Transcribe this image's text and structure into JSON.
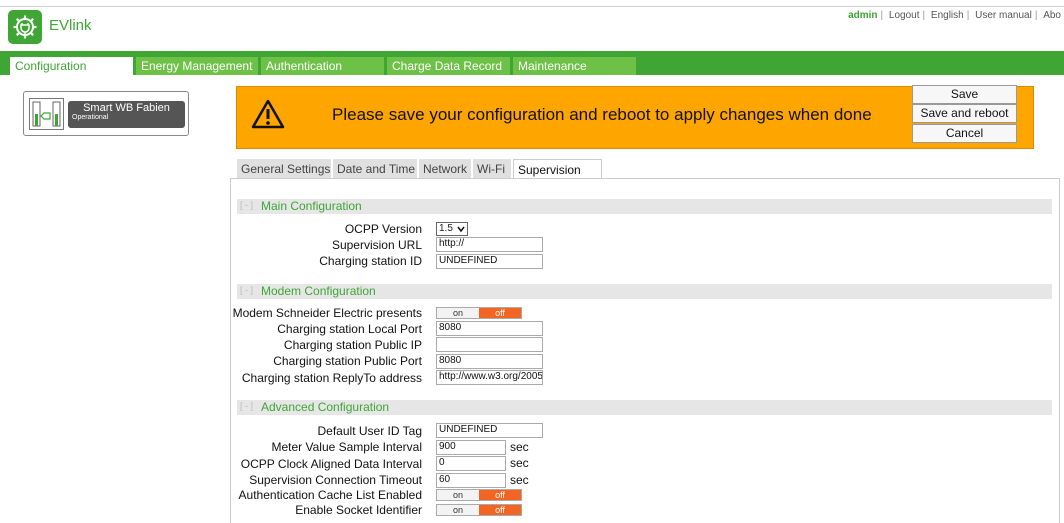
{
  "app": {
    "brand": "EVlink",
    "logo_icon": "gear-plug-icon",
    "accent": "#3fa535"
  },
  "toplinks": {
    "user": "admin",
    "logout": "Logout",
    "language": "English",
    "manual": "User manual",
    "about": "Abo"
  },
  "nav": {
    "tabs": [
      {
        "label": "Configuration",
        "active": true
      },
      {
        "label": "Energy Management"
      },
      {
        "label": "Authentication"
      },
      {
        "label": "Charge Data Record"
      },
      {
        "label": "Maintenance"
      }
    ]
  },
  "station": {
    "name": "Smart WB Fabien",
    "status": "Operational"
  },
  "banner": {
    "message": "Please save your configuration and reboot to apply changes when done",
    "color": "#ffa500"
  },
  "actions": {
    "save": "Save",
    "save_reboot": "Save and reboot",
    "cancel": "Cancel"
  },
  "subtabs": {
    "items": [
      {
        "label": "General Settings"
      },
      {
        "label": "Date and Time"
      },
      {
        "label": "Network"
      },
      {
        "label": "Wi-Fi"
      },
      {
        "label": "Supervision",
        "active": true
      }
    ],
    "help_icon": "?"
  },
  "main_config": {
    "toggle": "[ - ]",
    "title": "Main Configuration",
    "ocpp_version_label": "OCPP Version",
    "ocpp_version_value": "1.5",
    "supervision_url_label": "Supervision URL",
    "supervision_url_value": "http://",
    "station_id_label": "Charging station ID",
    "station_id_value": "UNDEFINED"
  },
  "modem_config": {
    "toggle": "[ - ]",
    "title": "Modem Configuration",
    "modem_presents_label": "Modem Schneider Electric presents",
    "local_port_label": "Charging station Local Port",
    "local_port_value": "8080",
    "public_ip_label": "Charging station Public IP",
    "public_ip_value": "",
    "public_port_label": "Charging station Public Port",
    "public_port_value": "8080",
    "replyto_label": "Charging station ReplyTo address",
    "replyto_value": "http://www.w3.org/2005/0"
  },
  "advanced_config": {
    "toggle": "[ - ]",
    "title": "Advanced Configuration",
    "default_user_label": "Default User ID Tag",
    "default_user_value": "UNDEFINED",
    "meter_interval_label": "Meter Value Sample Interval",
    "meter_interval_value": "900",
    "clock_interval_label": "OCPP Clock Aligned Data Interval",
    "clock_interval_value": "0",
    "timeout_label": "Supervision Connection Timeout",
    "timeout_value": "60",
    "auth_cache_label": "Authentication Cache List Enabled",
    "socket_id_label": "Enable Socket Identifier",
    "unit_sec": "sec"
  },
  "toggle": {
    "on": "on",
    "off": "off",
    "off_color": "#f26522"
  }
}
